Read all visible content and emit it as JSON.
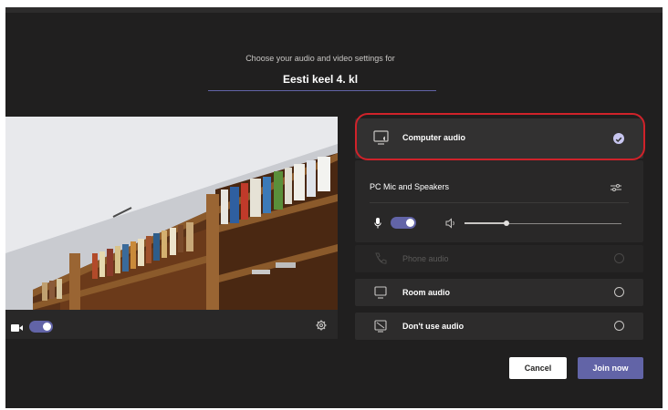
{
  "prejoin": {
    "subtitle": "Choose your audio and video settings for",
    "meeting_title": "Eesti keel 4. kl"
  },
  "video": {
    "camera_toggle_on": true,
    "camera_icon": "video-camera-icon",
    "settings_icon": "gear-icon"
  },
  "audio": {
    "options": [
      {
        "label": "Computer audio",
        "icon": "computer-audio-icon",
        "selected": true,
        "enabled": true
      },
      {
        "label": "Phone audio",
        "icon": "phone-icon",
        "selected": false,
        "enabled": false
      },
      {
        "label": "Room audio",
        "icon": "room-icon",
        "selected": false,
        "enabled": true
      },
      {
        "label": "Don't use audio",
        "icon": "no-audio-icon",
        "selected": false,
        "enabled": true
      }
    ],
    "device_label": "PC Mic and Speakers",
    "mic_on": true,
    "speaker_volume": 0.27
  },
  "actions": {
    "cancel_label": "Cancel",
    "join_label": "Join now"
  },
  "colors": {
    "accent": "#6264a7",
    "background": "#201f1f",
    "highlight_ring": "#d0222a"
  }
}
